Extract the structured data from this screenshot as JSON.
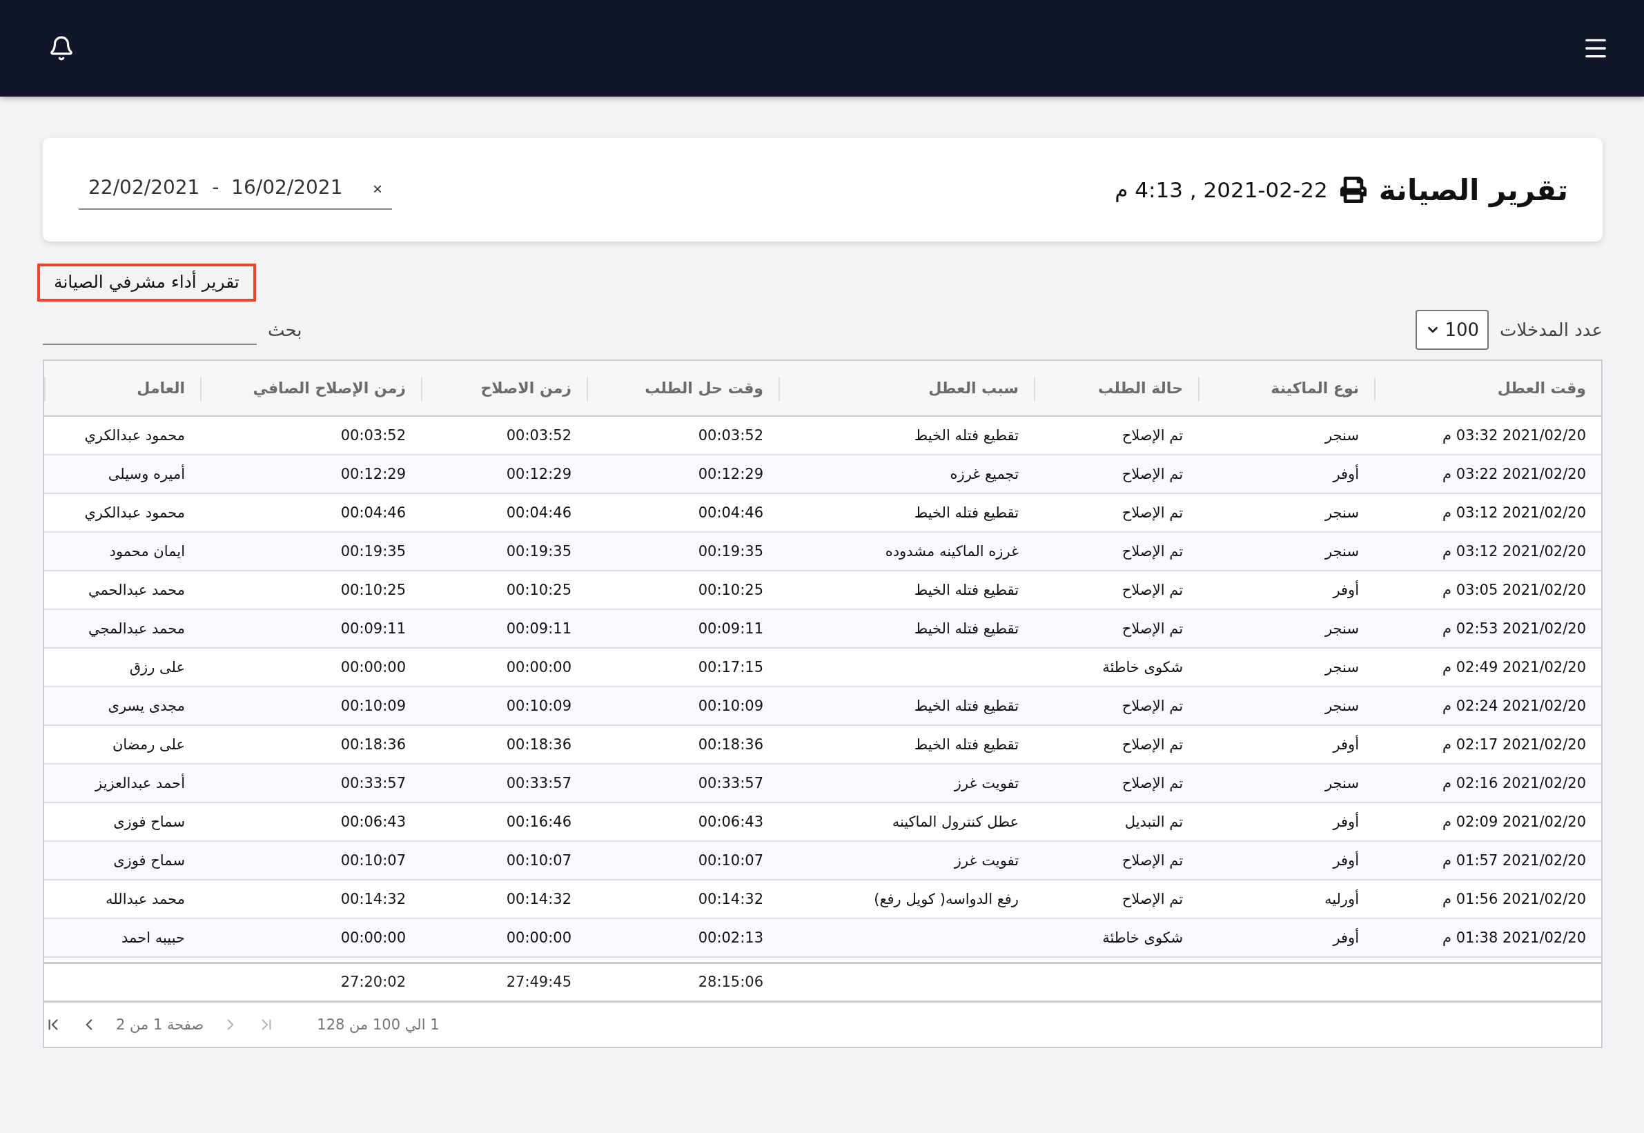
{
  "report": {
    "title": "تقرير الصيانة",
    "timestamp": "2021-02-22 , 4:13 م",
    "date_range": {
      "value": "22/02/2021  -  16/02/2021",
      "clear": "×"
    }
  },
  "section_title": "تقرير أداء مشرفي الصيانة",
  "entries": {
    "label": "عدد المدخلات",
    "value": "100"
  },
  "search": {
    "label": "بحث"
  },
  "table": {
    "columns": [
      "وقت العطل",
      "نوع الماكينة",
      "حالة الطلب",
      "سبب العطل",
      "وقت حل الطلب",
      "زمن الاصلاح",
      "زمن الإصلاح الصافي",
      "العامل"
    ],
    "rows": [
      {
        "time": "2021/02/20 03:32 م",
        "machine": "سنجر",
        "status": "تم الإصلاح",
        "reason": "تقطيع فتله الخيط",
        "resolve_time": "00:03:52",
        "repair_time": "00:03:52",
        "net_repair_time": "00:03:52",
        "worker": "محمود عبدالكري"
      },
      {
        "time": "2021/02/20 03:22 م",
        "machine": "أوفر",
        "status": "تم الإصلاح",
        "reason": "تجميع غرزه",
        "resolve_time": "00:12:29",
        "repair_time": "00:12:29",
        "net_repair_time": "00:12:29",
        "worker": "أميره وسيلى"
      },
      {
        "time": "2021/02/20 03:12 م",
        "machine": "سنجر",
        "status": "تم الإصلاح",
        "reason": "تقطيع فتله الخيط",
        "resolve_time": "00:04:46",
        "repair_time": "00:04:46",
        "net_repair_time": "00:04:46",
        "worker": "محمود عبدالكري"
      },
      {
        "time": "2021/02/20 03:12 م",
        "machine": "سنجر",
        "status": "تم الإصلاح",
        "reason": "غرزه الماكينه مشدوده",
        "resolve_time": "00:19:35",
        "repair_time": "00:19:35",
        "net_repair_time": "00:19:35",
        "worker": "ايمان محمود"
      },
      {
        "time": "2021/02/20 03:05 م",
        "machine": "أوفر",
        "status": "تم الإصلاح",
        "reason": "تقطيع فتله الخيط",
        "resolve_time": "00:10:25",
        "repair_time": "00:10:25",
        "net_repair_time": "00:10:25",
        "worker": "محمد عبدالحمي"
      },
      {
        "time": "2021/02/20 02:53 م",
        "machine": "سنجر",
        "status": "تم الإصلاح",
        "reason": "تقطيع فتله الخيط",
        "resolve_time": "00:09:11",
        "repair_time": "00:09:11",
        "net_repair_time": "00:09:11",
        "worker": "محمد عبدالمجي"
      },
      {
        "time": "2021/02/20 02:49 م",
        "machine": "سنجر",
        "status": "شكوى خاطئة",
        "resolve_time": "00:17:15",
        "repair_time": "00:00:00",
        "net_repair_time": "00:00:00",
        "worker": "على رزق"
      },
      {
        "time": "2021/02/20 02:24 م",
        "machine": "سنجر",
        "status": "تم الإصلاح",
        "reason": "تقطيع فتله الخيط",
        "resolve_time": "00:10:09",
        "repair_time": "00:10:09",
        "net_repair_time": "00:10:09",
        "worker": "مجدى يسرى"
      },
      {
        "time": "2021/02/20 02:17 م",
        "machine": "أوفر",
        "status": "تم الإصلاح",
        "reason": "تقطيع فتله الخيط",
        "resolve_time": "00:18:36",
        "repair_time": "00:18:36",
        "net_repair_time": "00:18:36",
        "worker": "على رمضان"
      },
      {
        "time": "2021/02/20 02:16 م",
        "machine": "سنجر",
        "status": "تم الإصلاح",
        "reason": "تفويت غرز",
        "resolve_time": "00:33:57",
        "repair_time": "00:33:57",
        "net_repair_time": "00:33:57",
        "worker": "أحمد عبدالعزيز"
      },
      {
        "time": "2021/02/20 02:09 م",
        "machine": "أوفر",
        "status": "تم التبديل",
        "reason": "عطل كنترول الماكينه",
        "resolve_time": "00:06:43",
        "repair_time": "00:16:46",
        "net_repair_time": "00:06:43",
        "worker": "سماح فوزى"
      },
      {
        "time": "2021/02/20 01:57 م",
        "machine": "أوفر",
        "status": "تم الإصلاح",
        "reason": "تفويت غرز",
        "resolve_time": "00:10:07",
        "repair_time": "00:10:07",
        "net_repair_time": "00:10:07",
        "worker": "سماح فوزى"
      },
      {
        "time": "2021/02/20 01:56 م",
        "machine": "أورليه",
        "status": "تم الإصلاح",
        "reason": "رفع الدواسه( كويل رفع)",
        "resolve_time": "00:14:32",
        "repair_time": "00:14:32",
        "net_repair_time": "00:14:32",
        "worker": "محمد عبدالله"
      },
      {
        "time": "2021/02/20 01:38 م",
        "machine": "أوفر",
        "status": "شكوى خاطئة",
        "resolve_time": "00:02:13",
        "repair_time": "00:00:00",
        "net_repair_time": "00:00:00",
        "worker": "حبيبه احمد"
      }
    ],
    "totals": {
      "resolve_time": "28:15:06",
      "repair_time": "27:49:45",
      "net_repair_time": "27:20:02"
    }
  },
  "pagination": {
    "range": "1 الي 100 من 128",
    "page": "صفحة 1 من 2",
    "buttons": [
      {
        "kind": "first",
        "disabled": true
      },
      {
        "kind": "prev",
        "disabled": true
      },
      {
        "kind": "next",
        "disabled": false
      },
      {
        "kind": "last",
        "disabled": false
      }
    ]
  }
}
